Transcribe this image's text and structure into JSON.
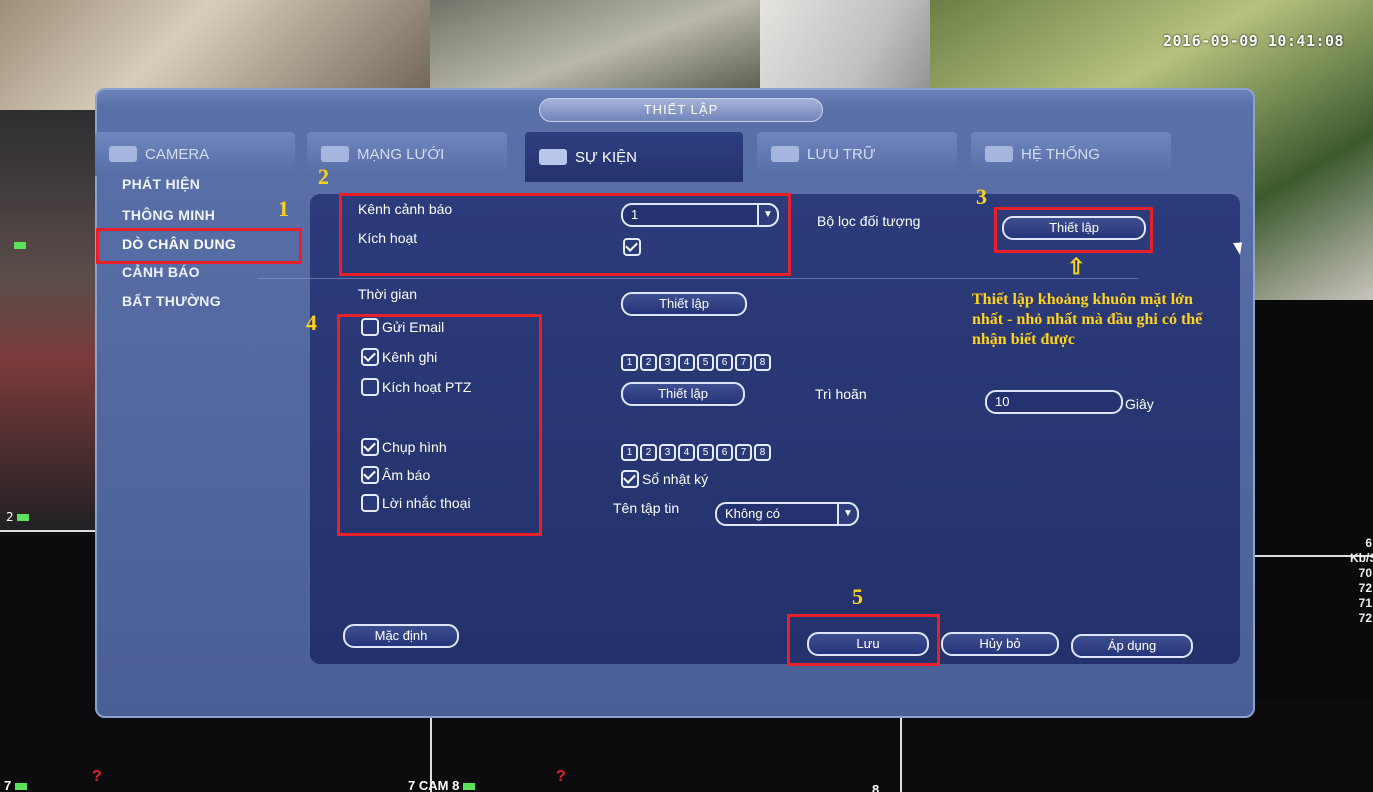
{
  "background": {
    "timestamp": "2016-09-09 10:41:08",
    "stats": [
      "6",
      "Kb/S",
      "70",
      "72",
      "71",
      "72"
    ],
    "left_channels": [
      "2"
    ],
    "bottom_labels": {
      "cam7": "7",
      "cam8_num": "7",
      "cam8": "CAM 8",
      "right_num": "8"
    }
  },
  "dialog": {
    "title": "THIẾT LẬP",
    "tabs": [
      {
        "label": "CAMERA",
        "icon": "camera-icon"
      },
      {
        "label": "MẠNG LƯỚI",
        "icon": "network-icon"
      },
      {
        "label": "SỰ KIỆN",
        "icon": "event-icon",
        "active": true
      },
      {
        "label": "LƯU TRỮ",
        "icon": "storage-icon"
      },
      {
        "label": "HỆ THỐNG",
        "icon": "system-icon"
      }
    ],
    "sidebar": [
      {
        "label": "PHÁT HIỆN"
      },
      {
        "label": "THÔNG MINH"
      },
      {
        "label": "DÒ CHÂN DUNG",
        "active": true
      },
      {
        "label": "CẢNH BÁO"
      },
      {
        "label": "BẤT THƯỜNG"
      }
    ],
    "form": {
      "channel_label": "Kênh cảnh báo",
      "channel_value": "1",
      "enable_label": "Kích hoạt",
      "enable_checked": true,
      "object_filter_label": "Bộ lọc đối tượng",
      "object_filter_button": "Thiết lập",
      "schedule_label": "Thời gian",
      "schedule_button": "Thiết lập",
      "send_email_label": "Gửi Email",
      "send_email_checked": false,
      "record_label": "Kênh ghi",
      "record_checked": true,
      "record_channels": [
        "1",
        "2",
        "3",
        "4",
        "5",
        "6",
        "7",
        "8"
      ],
      "ptz_label": "Kích hoạt PTZ",
      "ptz_checked": false,
      "ptz_button": "Thiết lập",
      "delay_label": "Trì hoãn",
      "delay_value": "10",
      "delay_unit": "Giây",
      "snapshot_label": "Chụp hình",
      "snapshot_checked": true,
      "snapshot_channels": [
        "1",
        "2",
        "3",
        "4",
        "5",
        "6",
        "7",
        "8"
      ],
      "buzzer_label": "Âm báo",
      "buzzer_checked": true,
      "log_label": "Sổ nhật ký",
      "log_checked": true,
      "voice_label": "Lời nhắc thoại",
      "voice_checked": false,
      "filename_label": "Tên tập tin",
      "filename_value": "Không có"
    },
    "buttons": {
      "default": "Mặc định",
      "save": "Lưu",
      "cancel": "Hủy bỏ",
      "apply": "Áp dụng"
    }
  },
  "annotations": {
    "numbers": [
      "1",
      "2",
      "3",
      "4",
      "5"
    ],
    "note": "Thiết lập khoảng khuôn mặt lớn nhất - nhỏ nhất mà đầu ghi có thể nhận biết được",
    "arrow": "⇧",
    "highlight_color": "#e8202a",
    "text_color": "#ffd21c"
  }
}
